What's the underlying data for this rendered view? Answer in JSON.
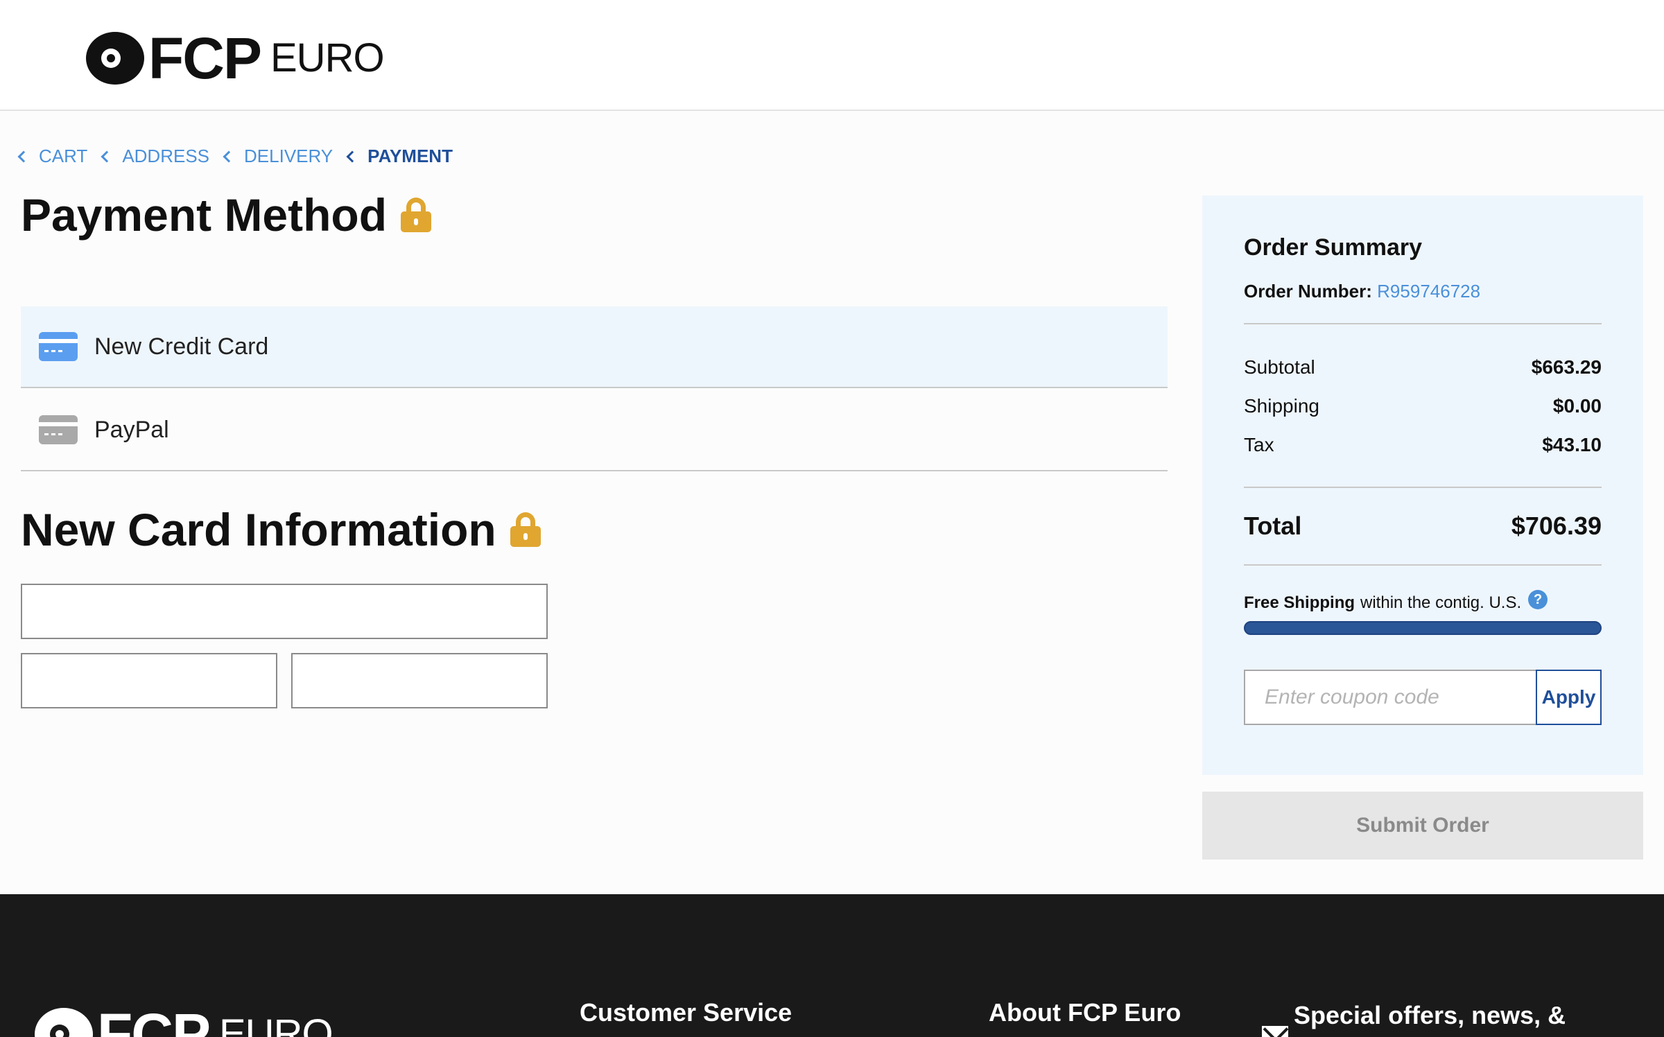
{
  "brand": {
    "logo_main": "FCP",
    "logo_sub": "EURO"
  },
  "breadcrumb": [
    {
      "label": "CART"
    },
    {
      "label": "ADDRESS"
    },
    {
      "label": "DELIVERY"
    },
    {
      "label": "PAYMENT"
    }
  ],
  "payment": {
    "title": "Payment Method",
    "options": [
      {
        "label": "New Credit Card",
        "icon": "credit-card-icon",
        "selected": true
      },
      {
        "label": "PayPal",
        "icon": "credit-card-icon",
        "selected": false
      }
    ]
  },
  "card_info": {
    "title": "New Card Information"
  },
  "summary": {
    "title": "Order Summary",
    "order_number_label": "Order Number:",
    "order_number": "R959746728",
    "subtotal_label": "Subtotal",
    "subtotal": "$663.29",
    "shipping_label": "Shipping",
    "shipping": "$0.00",
    "tax_label": "Tax",
    "tax": "$43.10",
    "total_label": "Total",
    "total": "$706.39",
    "free_shipping_bold": "Free Shipping",
    "free_shipping_rest": "within the contig. U.S.",
    "free_shipping_progress": 1.0,
    "coupon_placeholder": "Enter coupon code",
    "apply_label": "Apply"
  },
  "submit_label": "Submit Order",
  "footer": {
    "customer_service": "Customer Service",
    "about": "About FCP Euro",
    "offers": "Special offers, news, &"
  },
  "colors": {
    "accent_blue": "#4a90d9",
    "dark_blue": "#1f4f9a",
    "lock_gold": "#e0a630",
    "summary_bg": "#eef6fd",
    "footer_bg": "#1a1a1a"
  }
}
